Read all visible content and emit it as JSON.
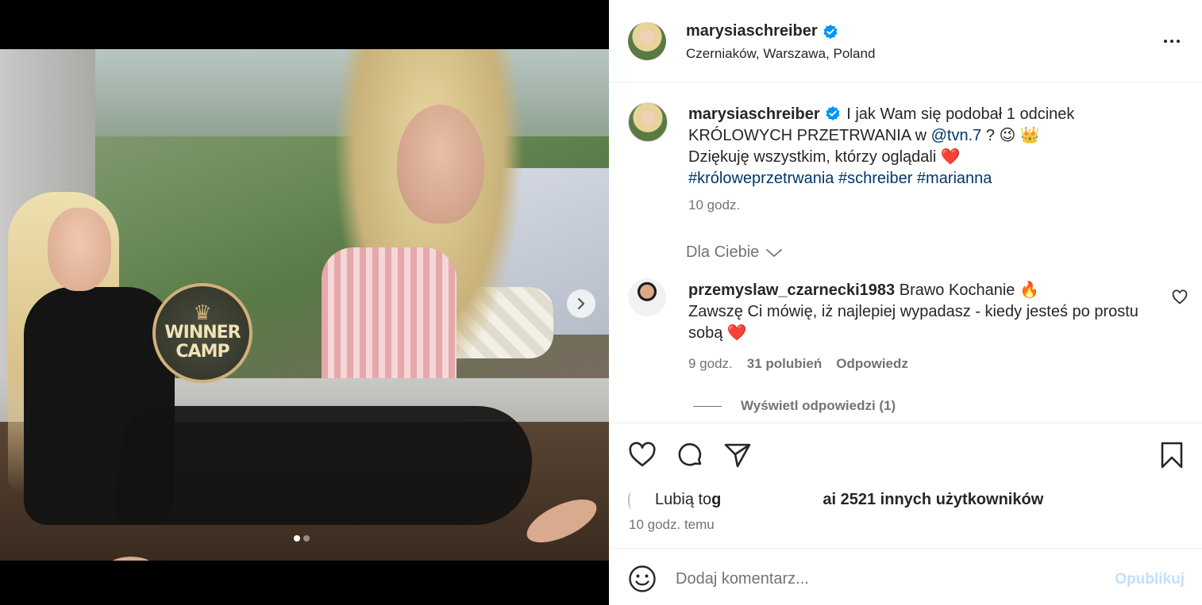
{
  "post": {
    "username": "marysiaschreiber",
    "location": "Czerniaków, Warszawa, Poland",
    "media": {
      "badge_line1": "WINNER",
      "badge_line2": "CAMP",
      "carousel_count": 2,
      "carousel_active": 1
    }
  },
  "caption": {
    "username": "marysiaschreiber",
    "text_1": " I jak Wam się podobał 1 odcinek KRÓLOWYCH PRZETRWANIA w ",
    "mention": "@tvn.7",
    "text_2": " ? 😉 👑",
    "line_2": "Dziękuję wszystkim, którzy oglądali ❤️",
    "hashtags": "#króloweprzetrwania #schreiber #marianna",
    "time": "10 godz."
  },
  "sort": {
    "label": "Dla Ciebie"
  },
  "comment": {
    "username": "przemyslaw_czarnecki1983",
    "text_1": " Brawo Kochanie 🔥",
    "text_2": "Zawszę Ci mówię, iż najlepiej wypadasz - kiedy jesteś po prostu sobą ❤️",
    "time": "9 godz.",
    "likes": "31 polubień",
    "reply": "Odpowiedz",
    "view_replies": "Wyświetl odpowiedzi (1)"
  },
  "likes": {
    "prefix": "Lubią to ",
    "user_start": "g",
    "user_end": "a",
    "rest": " i 2521 innych użytkowników"
  },
  "post_time": "10 godz. temu",
  "add_comment": {
    "placeholder": "Dodaj komentarz...",
    "publish": "Opublikuj"
  },
  "colors": {
    "verified": "#0095f6",
    "link": "#00376b",
    "heart": "#ed4956",
    "publish_disabled": "#c0dffd"
  }
}
